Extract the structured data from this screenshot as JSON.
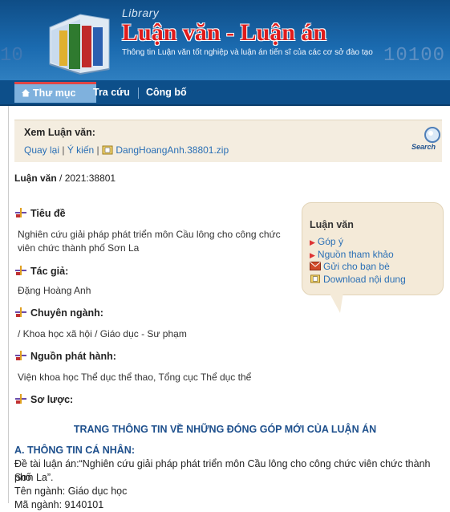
{
  "header": {
    "library_word": "Library",
    "site_title": "Luận văn - Luận án",
    "subtitle": "Thông tin Luận văn tốt nghiệp và luận án tiến sĩ của các cơ sở đào tạo",
    "binary_right": "10100",
    "binary_left": "10"
  },
  "nav": {
    "tabs": [
      {
        "label": "Thư mục"
      },
      {
        "label": "Tra cứu"
      },
      {
        "label": "Công bố"
      }
    ]
  },
  "view": {
    "title": "Xem Luận văn:",
    "back": "Quay lại",
    "sep1": "|",
    "feedback": "Ý kiến",
    "sep2": "|",
    "file": "DangHoangAnh.38801.zip",
    "search_label": "Search"
  },
  "breadcrumb": {
    "type": "Luận văn",
    "id": " / 2021:38801"
  },
  "fields": {
    "title_label": "Tiêu đề",
    "title_line1": "Nghiên cứu giải pháp phát triển môn Cầu lông cho công chức",
    "title_line2": "viên chức thành phố Sơn La",
    "author_label": "Tác giả:",
    "author": "Đặng Hoàng Anh",
    "major_label": "Chuyên ngành:",
    "major": " / Khoa học xã hội / Giáo dục - Sư phạm",
    "publisher_label": "Nguồn phát hành:",
    "publisher": "Viện khoa học Thể dục thể thao, Tổng cục Thể dục thể",
    "summary_label": "Sơ lược:"
  },
  "sidebox": {
    "title": "Luận văn",
    "items": [
      {
        "label": "Góp ý"
      },
      {
        "label": "Nguồn tham khảo"
      },
      {
        "label": "Gửi cho bạn bè"
      },
      {
        "label": "Download nội dung"
      }
    ]
  },
  "article": {
    "heading": "TRANG THÔNG TIN VỀ NHỮNG ĐÓNG GÓP MỚI CỦA LUẬN ÁN",
    "section_a": "A. THÔNG TIN CÁ NHÂN:",
    "line1": "Đề tài luận án:“Nghiên cứu giải pháp phát triển môn Cầu lông cho công chức viên chức thành phố",
    "line2": "Sơn La”.",
    "line3": "Tên ngành: Giáo dục học",
    "line4": "Mã ngành: 9140101"
  },
  "colors": {
    "banner": "#1b6bb0",
    "nav": "#0d4f8a",
    "title_red": "#e01b1b",
    "link": "#2a6fb5",
    "heading_blue": "#1d4f8c",
    "box_beige": "#f4ead8"
  }
}
